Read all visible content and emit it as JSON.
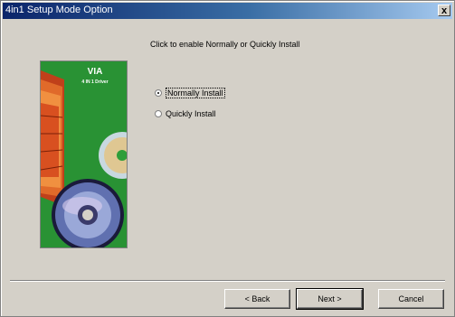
{
  "window": {
    "title": "4in1 Setup Mode Option",
    "close_glyph": "x"
  },
  "content": {
    "instruction": "Click to enable Normally or Quickly Install",
    "banner": {
      "brand": "VIA",
      "subtitle": "4 IN 1 Driver"
    },
    "options": [
      {
        "label": "Normally Install",
        "selected": true
      },
      {
        "label": "Quickly Install",
        "selected": false
      }
    ]
  },
  "buttons": {
    "back": "< Back",
    "next": "Next >",
    "cancel": "Cancel"
  },
  "colors": {
    "title_gradient_start": "#0a246a",
    "window_face": "#d4d0c8",
    "banner_green": "#2e9e3a"
  }
}
